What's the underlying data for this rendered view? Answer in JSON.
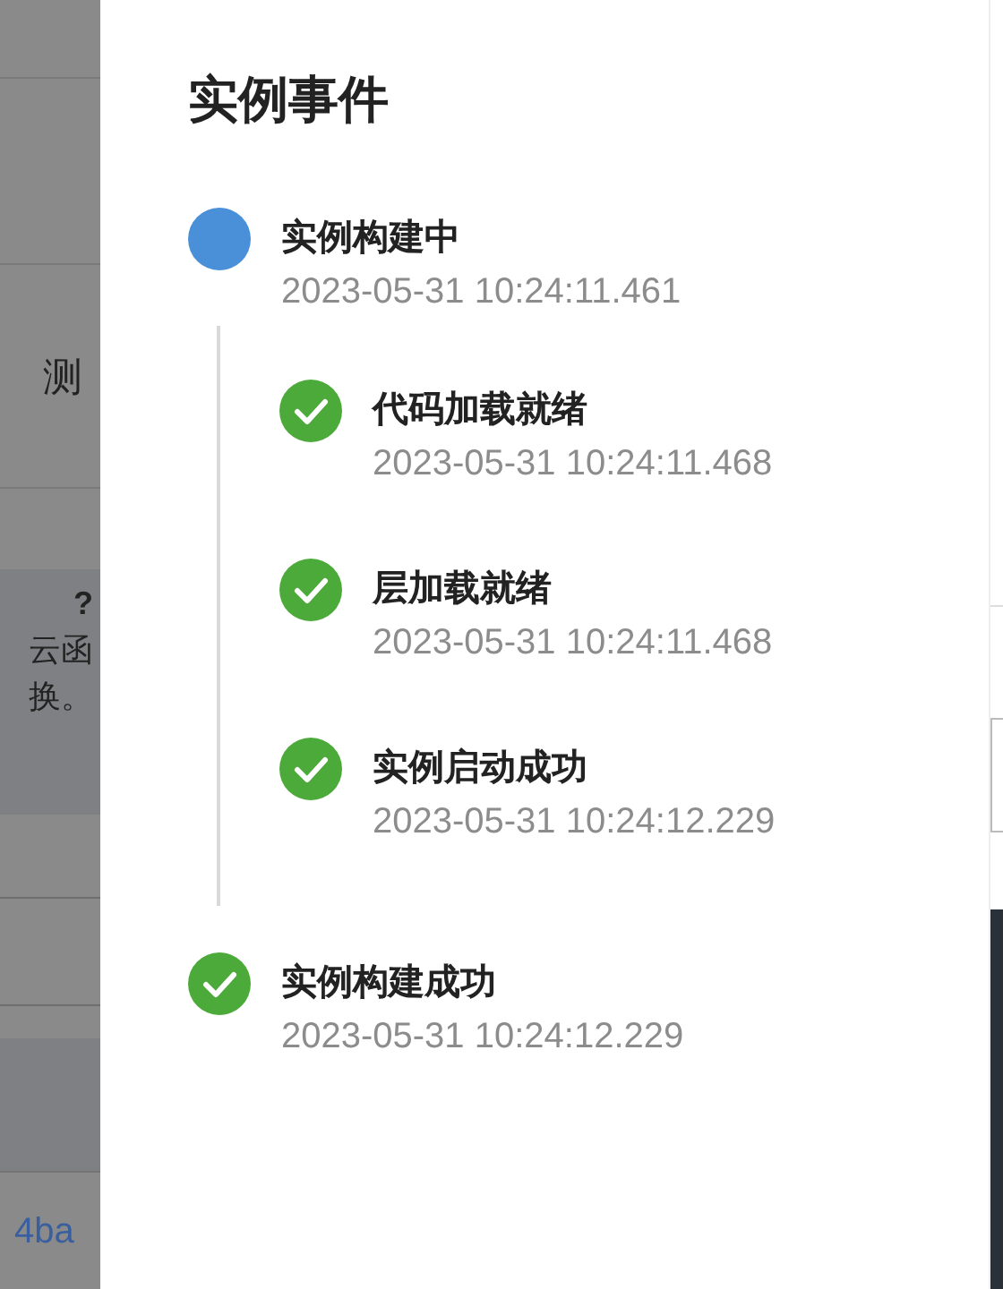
{
  "background": {
    "row_text": "测",
    "notice_title": "?",
    "notice_lines": [
      "云函",
      "换。"
    ],
    "link_text": "4ba"
  },
  "drawer": {
    "title": "实例事件",
    "events": [
      {
        "label": "实例构建中",
        "time": "2023-05-31 10:24:11.461",
        "kind": "running",
        "children": [
          {
            "label": "代码加载就绪",
            "time": "2023-05-31 10:24:11.468",
            "kind": "success"
          },
          {
            "label": "层加载就绪",
            "time": "2023-05-31 10:24:11.468",
            "kind": "success"
          },
          {
            "label": "实例启动成功",
            "time": "2023-05-31 10:24:12.229",
            "kind": "success"
          }
        ]
      },
      {
        "label": "实例构建成功",
        "time": "2023-05-31 10:24:12.229",
        "kind": "success"
      }
    ]
  }
}
